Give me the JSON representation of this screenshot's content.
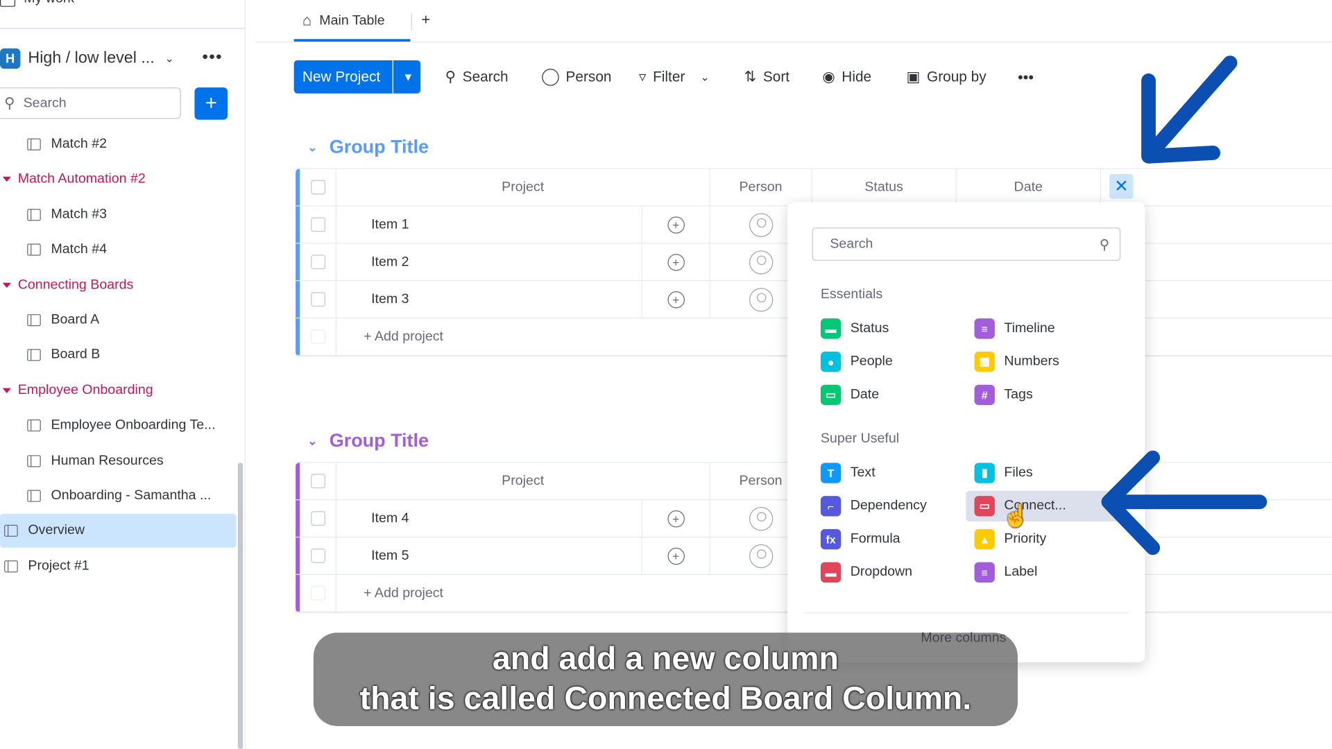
{
  "sidebar": {
    "my_work": "My work",
    "workspace_initial": "H",
    "workspace_name": "High / low level ...",
    "search_placeholder": "Search",
    "items": [
      {
        "label": "Match #2",
        "type": "board"
      },
      {
        "label": "Match Automation #2",
        "type": "folder"
      },
      {
        "label": "Match #3",
        "type": "board"
      },
      {
        "label": "Match #4",
        "type": "board"
      },
      {
        "label": "Connecting Boards",
        "type": "folder"
      },
      {
        "label": "Board A",
        "type": "board"
      },
      {
        "label": "Board B",
        "type": "board"
      },
      {
        "label": "Employee Onboarding",
        "type": "folder"
      },
      {
        "label": "Employee Onboarding Te...",
        "type": "board"
      },
      {
        "label": "Human Resources",
        "type": "board"
      },
      {
        "label": "Onboarding - Samantha ...",
        "type": "board"
      },
      {
        "label": "Overview",
        "type": "board",
        "selected": true
      },
      {
        "label": "Project #1",
        "type": "board"
      }
    ]
  },
  "tabs": {
    "main": "Main Table",
    "add": "+"
  },
  "toolbar": {
    "new_project": "New Project",
    "search": "Search",
    "person": "Person",
    "filter": "Filter",
    "sort": "Sort",
    "hide": "Hide",
    "group_by": "Group by"
  },
  "groups": [
    {
      "title": "Group Title",
      "color": "#579bfc",
      "columns": [
        "Project",
        "Person",
        "Status",
        "Date"
      ],
      "items": [
        "Item 1",
        "Item 2",
        "Item 3"
      ],
      "add": "+ Add project"
    },
    {
      "title": "Group Title",
      "color": "#a25ddc",
      "columns": [
        "Project",
        "Person"
      ],
      "items": [
        "Item 4",
        "Item 5"
      ],
      "add": "+ Add project"
    }
  ],
  "column_picker": {
    "search_placeholder": "Search",
    "sections": [
      {
        "title": "Essentials",
        "options": [
          {
            "label": "Status",
            "color": "#00c875"
          },
          {
            "label": "Timeline",
            "color": "#a25ddc"
          },
          {
            "label": "People",
            "color": "#00c2e0"
          },
          {
            "label": "Numbers",
            "color": "#ffcb00"
          },
          {
            "label": "Date",
            "color": "#00c875"
          },
          {
            "label": "Tags",
            "color": "#a25ddc"
          }
        ]
      },
      {
        "title": "Super Useful",
        "options": [
          {
            "label": "Text",
            "color": "#0d99ff"
          },
          {
            "label": "Files",
            "color": "#00c2e0"
          },
          {
            "label": "Dependency",
            "color": "#5559df"
          },
          {
            "label": "Connect...",
            "color": "#e2445c",
            "hovered": true
          },
          {
            "label": "Formula",
            "color": "#5559df"
          },
          {
            "label": "Priority",
            "color": "#ffcb00"
          },
          {
            "label": "Dropdown",
            "color": "#e2445c"
          },
          {
            "label": "Label",
            "color": "#a25ddc"
          }
        ]
      }
    ],
    "more": "More columns"
  },
  "caption": {
    "line1": "and add a new column",
    "line2": "that is called Connected Board Column."
  },
  "colors": {
    "primary": "#0073ea",
    "arrow": "#0b4fb3",
    "folder": "#c2185b"
  }
}
